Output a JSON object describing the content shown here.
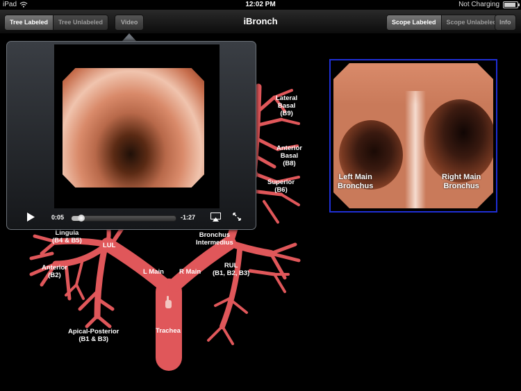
{
  "status_bar": {
    "device": "iPad",
    "time": "12:02 PM",
    "charging": "Not Charging"
  },
  "toolbar": {
    "title": "iBronch",
    "tree_segments": [
      {
        "label": "Tree Labeled",
        "selected": true
      },
      {
        "label": "Tree Unlabeled",
        "selected": false
      }
    ],
    "video_button": "Video",
    "scope_segments": [
      {
        "label": "Scope Labeled",
        "selected": true
      },
      {
        "label": "Scope Unlabeled",
        "selected": false
      }
    ],
    "info_button": "Info"
  },
  "video_player": {
    "elapsed": "0:05",
    "remaining": "-1:27",
    "progress_fraction": 0.06
  },
  "tree_labels": {
    "lateral_basal": [
      "Lateral",
      "Basal",
      "(B9)"
    ],
    "anterior_basal": [
      "Anterior",
      "Basal",
      "(B8)"
    ],
    "superior": [
      "Superior",
      "(B6)"
    ],
    "lingula": [
      "Lingula",
      "(B4 & B5)"
    ],
    "lul": "LUL",
    "anterior": [
      "Anterior",
      "(B2)"
    ],
    "apical_posterior": [
      "Apical-Posterior",
      "(B1 & B3)"
    ],
    "l_main": "L Main",
    "r_main": "R Main",
    "bronchus_intermedius": [
      "Bronchus",
      "Intermedius"
    ],
    "rul": [
      "RUL",
      "(B1, B2, B3)"
    ],
    "trachea": "Trachea"
  },
  "scope_view": {
    "left_label": [
      "Left Main",
      "Bronchus"
    ],
    "right_label": [
      "Right Main",
      "Bronchus"
    ]
  },
  "colors": {
    "airway": "#e0575a",
    "scope_border": "#1f2fd6"
  }
}
